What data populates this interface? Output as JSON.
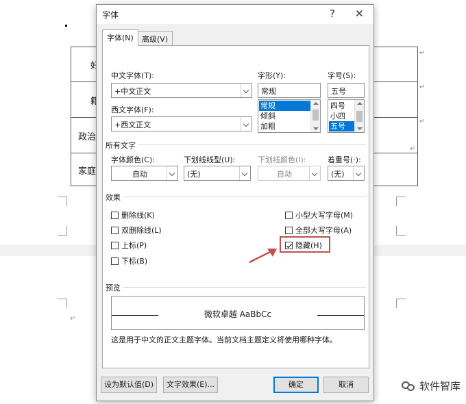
{
  "background_doc": {
    "cells": [
      "好",
      "籍",
      "政治",
      "家庭"
    ]
  },
  "dialog": {
    "title": "字体",
    "help_label": "?",
    "close_label": "✕",
    "tabs": [
      {
        "label": "字体(N)",
        "active": true
      },
      {
        "label": "高级(V)",
        "active": false
      }
    ],
    "chinese_font": {
      "label": "中文字体(T):",
      "value": "+中文正文"
    },
    "western_font": {
      "label": "西文字体(F):",
      "value": "+西文正文"
    },
    "style": {
      "label": "字形(Y):",
      "value": "常规",
      "options": [
        "常规",
        "倾斜",
        "加粗"
      ],
      "selected": "常规"
    },
    "size": {
      "label": "字号(S):",
      "value": "五号",
      "options": [
        "四号",
        "小四",
        "五号"
      ],
      "selected": "五号"
    },
    "all_text": {
      "title": "所有文字",
      "font_color": {
        "label": "字体颜色(C):",
        "value": "自动"
      },
      "underline_type": {
        "label": "下划线线型(U):",
        "value": "(无)"
      },
      "underline_color": {
        "label": "下划线颜色(I):",
        "value": "自动"
      },
      "emphasis": {
        "label": "着重号(·):",
        "value": "(无)"
      }
    },
    "effects": {
      "title": "效果",
      "strikethrough": {
        "label": "删除线(K)",
        "checked": false
      },
      "double_strikethrough": {
        "label": "双删除线(L)",
        "checked": false
      },
      "superscript": {
        "label": "上标(P)",
        "checked": false
      },
      "subscript": {
        "label": "下标(B)",
        "checked": false
      },
      "small_caps": {
        "label": "小型大写字母(M)",
        "checked": false
      },
      "all_caps": {
        "label": "全部大写字母(A)",
        "checked": false
      },
      "hidden": {
        "label": "隐藏(H)",
        "checked": true
      }
    },
    "preview": {
      "title": "预览",
      "sample": "微软卓越  AaBbCc",
      "note": "这是用于中文的正文主题字体。当前文档主题定义将使用哪种字体。"
    },
    "buttons": {
      "set_default": "设为默认值(D)",
      "text_effects": "文字效果(E)...",
      "ok": "确定",
      "cancel": "取消"
    },
    "colors": {
      "highlight": "#c0504d",
      "selection": "#0078d7"
    }
  },
  "watermark": {
    "text": "软件智库"
  }
}
